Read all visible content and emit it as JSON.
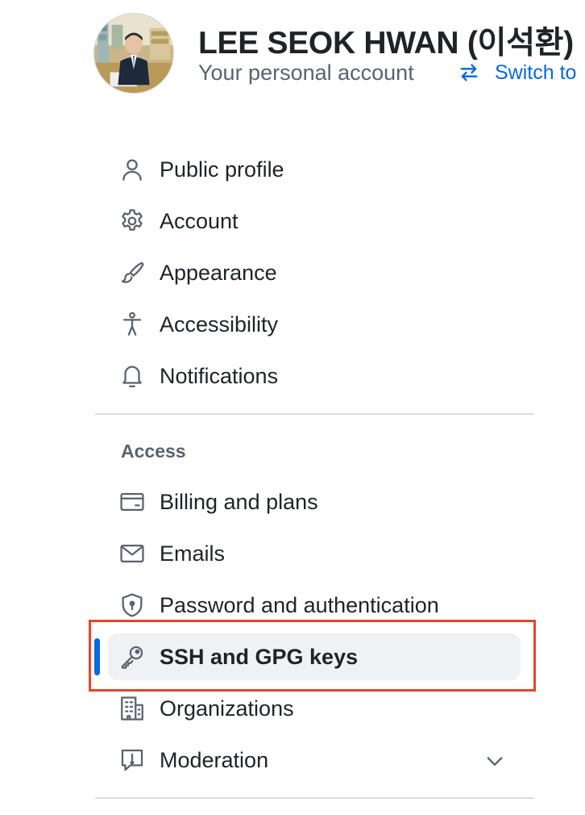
{
  "header": {
    "name": "LEE SEOK HWAN (이석환)",
    "subtitle": "Your personal account",
    "switch_label": "Switch to"
  },
  "nav": {
    "items": [
      {
        "label": "Public profile",
        "icon": "person-icon"
      },
      {
        "label": "Account",
        "icon": "gear-icon"
      },
      {
        "label": "Appearance",
        "icon": "paintbrush-icon"
      },
      {
        "label": "Accessibility",
        "icon": "accessibility-icon"
      },
      {
        "label": "Notifications",
        "icon": "bell-icon"
      }
    ],
    "access_heading": "Access",
    "access_items": [
      {
        "label": "Billing and plans",
        "icon": "credit-card-icon"
      },
      {
        "label": "Emails",
        "icon": "mail-icon"
      },
      {
        "label": "Password and authentication",
        "icon": "shield-lock-icon"
      },
      {
        "label": "SSH and GPG keys",
        "icon": "key-icon",
        "active": true
      },
      {
        "label": "Organizations",
        "icon": "organization-icon"
      },
      {
        "label": "Moderation",
        "icon": "report-icon",
        "expandable": true
      }
    ]
  },
  "colors": {
    "accent": "#0969da",
    "highlight_border": "#e5452c",
    "active_background": "#f0f1f3"
  }
}
